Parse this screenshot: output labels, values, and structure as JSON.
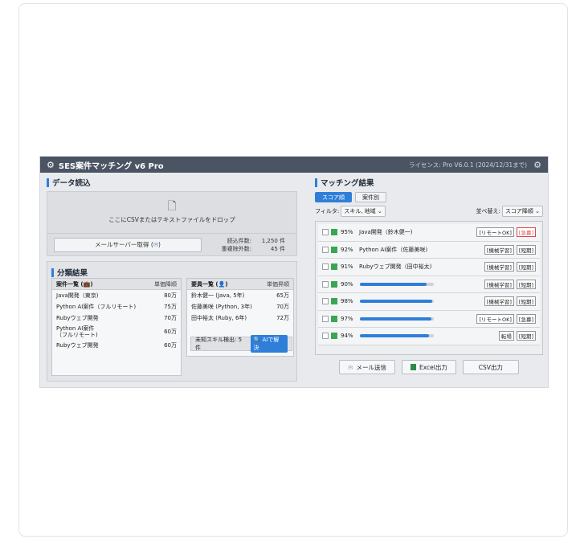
{
  "app": {
    "logo_icon": "⚙",
    "title": "SES案件マッチング v6 Pro",
    "license": "ライセンス: Pro V6.0.1 (2024/12/31まで)"
  },
  "data_load": {
    "title": "データ読込",
    "drop_text": "ここにCSVまたはテキストファイルをドロップ",
    "mail_button": "メールサーバー取得",
    "stats": [
      {
        "label": "読込件数:",
        "value": "1,250 件"
      },
      {
        "label": "重複除外数:",
        "value": "45 件"
      }
    ]
  },
  "classification": {
    "title": "分類結果",
    "projects": {
      "header": "案件一覧",
      "sort": "単価降順",
      "rows": [
        {
          "name": "Java開発（東京)",
          "price": "80万"
        },
        {
          "name": "Python AI案件（フルリモート)",
          "price": "75万"
        },
        {
          "name": "Rubyウェブ開発",
          "price": "70万"
        },
        {
          "name": "Python AI案件\n（フルリモート)",
          "price": "60万"
        },
        {
          "name": "Rubyウェブ開発",
          "price": "60万"
        }
      ]
    },
    "staff": {
      "header": "要員一覧",
      "sort": "単価昇順",
      "rows": [
        {
          "name": "鈴木健一 (Java, 5年)",
          "price": "65万"
        },
        {
          "name": "佐藤美咲 (Python, 3年)",
          "price": "70万"
        },
        {
          "name": "田中裕太 (Ruby, 6年)",
          "price": "72万"
        }
      ]
    },
    "unknown_skill": "未知スキル検出: 5件",
    "ai_button": "AIで解決"
  },
  "matching": {
    "title": "マッチング結果",
    "tabs": [
      "スコア順",
      "案件別"
    ],
    "filter_label": "フィルタ:",
    "filter_value": "スキル, 地域",
    "sort_label": "並べ替え:",
    "sort_value": "スコア降順",
    "rows": [
      {
        "score": "95%",
        "name": "Java開発（鈴木健一)",
        "progress": null,
        "tags": [
          {
            "t": "[リモートOK]",
            "red": false
          },
          {
            "t": "[急募]",
            "red": true
          }
        ]
      },
      {
        "score": "92%",
        "name": "Python AI案件（佐藤美咲)",
        "progress": null,
        "tags": [
          {
            "t": "[機械学習]",
            "red": false
          },
          {
            "t": "[短期]",
            "red": false
          }
        ]
      },
      {
        "score": "91%",
        "name": "Rubyウェブ開発（田中裕太)",
        "progress": null,
        "tags": [
          {
            "t": "[機械学習]",
            "red": false
          },
          {
            "t": "[短期]",
            "red": false
          }
        ]
      },
      {
        "score": "90%",
        "name": "",
        "progress": 0.9,
        "tags": [
          {
            "t": "[機械学習]",
            "red": false
          },
          {
            "t": "[短期]",
            "red": false
          }
        ]
      },
      {
        "score": "98%",
        "name": "",
        "progress": 0.98,
        "tags": [
          {
            "t": "[機械学習]",
            "red": false
          },
          {
            "t": "[短期]",
            "red": false
          }
        ]
      },
      {
        "score": "97%",
        "name": "",
        "progress": 0.97,
        "tags": [
          {
            "t": "[リモートOK]",
            "red": false
          },
          {
            "t": "[急募]",
            "red": false
          }
        ]
      },
      {
        "score": "94%",
        "name": "",
        "progress": 0.94,
        "tags": [
          {
            "t": "転場",
            "red": false
          },
          {
            "t": "[短期]",
            "red": false
          }
        ]
      }
    ],
    "buttons": {
      "mail": "メール送信",
      "excel": "Excel出力",
      "csv": "CSV出力"
    }
  }
}
